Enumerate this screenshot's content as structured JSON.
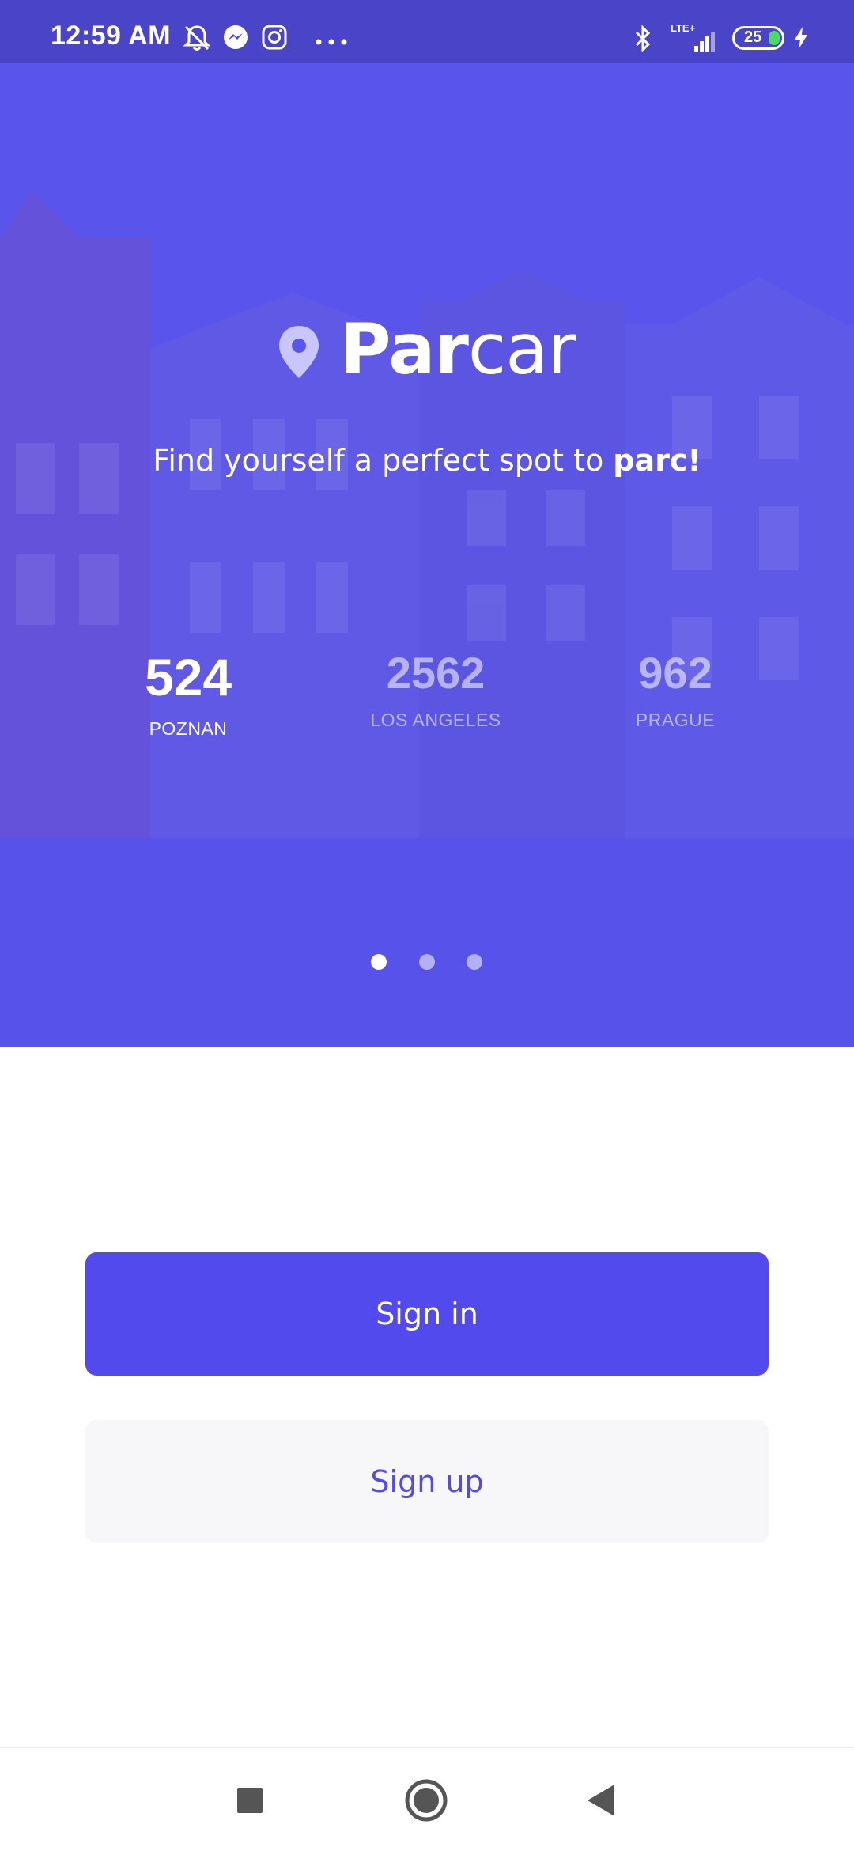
{
  "status_bar": {
    "time": "12:59 AM",
    "network": "LTE+",
    "battery": "25",
    "icons": [
      "mute-bell-icon",
      "messenger-icon",
      "instagram-icon",
      "more-dots-icon",
      "bluetooth-icon",
      "signal-icon",
      "battery-icon",
      "charging-icon"
    ]
  },
  "hero": {
    "logo_bold": "Par",
    "logo_light": "car",
    "tagline_prefix": "Find yourself a perfect spot to ",
    "tagline_bold": "parc!",
    "stats": [
      {
        "value": "524",
        "label": "POZNAN"
      },
      {
        "value": "2562",
        "label": "LOS ANGELES"
      },
      {
        "value": "962",
        "label": "PRAGUE"
      }
    ],
    "carousel": {
      "count": 3,
      "active_index": 0
    }
  },
  "actions": {
    "sign_in": "Sign in",
    "sign_up": "Sign up"
  },
  "colors": {
    "brand": "#534aee",
    "status_bar": "#4a44c9",
    "secondary_button_bg": "#f7f7f9"
  },
  "nav": {
    "icons": [
      "recents-square-icon",
      "home-circle-icon",
      "back-triangle-icon"
    ]
  }
}
